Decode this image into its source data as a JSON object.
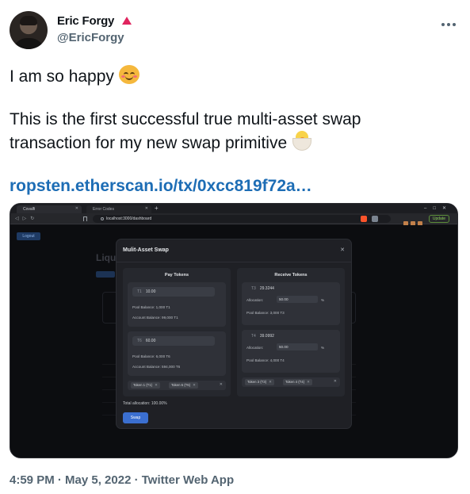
{
  "tweet": {
    "display_name": "Eric Forgy",
    "handle": "@EricForgy",
    "text_line1": "I am so happy",
    "text_line2": "This is the first successful true multi-asset swap",
    "text_line3": "transaction for my new swap primitive",
    "link": "ropsten.etherscan.io/tx/0xcc819f72a…",
    "meta": "4:59 PM · May 5, 2022 · Twitter Web App",
    "emoji_1": "smiling-face-with-smiling-eyes",
    "emoji_2": "hatching-chick",
    "badge_color": "#e0245e",
    "link_color": "#1d6db5"
  },
  "browser": {
    "tab_active": "Covalfi",
    "tab_second": "Error Codes",
    "url": "localhost:3000/dashboard",
    "update_label": "Update"
  },
  "app": {
    "logout_label": "Logout",
    "bg_title": "Liqu",
    "modal": {
      "title": "Mulit-Asset Swap",
      "pay_title": "Pay Tokens",
      "receive_title": "Receive Tokens",
      "pay_tokens": [
        {
          "symbol": "T1",
          "amount": "10.00",
          "pool_balance": "Pool Balance:   1,000   T1",
          "account_balance": "Account Balance:   99,000   T1"
        },
        {
          "symbol": "T6",
          "amount": "60.00",
          "pool_balance": "Pool Balance:   6,000   T6",
          "account_balance": "Account Balance:   594,000   T6"
        }
      ],
      "receive_tokens": [
        {
          "symbol": "T3",
          "amount": "29.3244",
          "allocation_label": "Allocation:",
          "allocation": "50.00",
          "pct": "%",
          "pool_balance": "Pool Balance:   3,000   T3"
        },
        {
          "symbol": "T4",
          "amount": "39.0992",
          "allocation_label": "Allocation:",
          "allocation": "50.00",
          "pct": "%",
          "pool_balance": "Pool Balance:   4,000   T4"
        }
      ],
      "pay_chips": [
        "Token 1 (T1)",
        "Token 6 (T6)"
      ],
      "receive_chips": [
        "Token 3 (T3)",
        "Token 4 (T4)"
      ],
      "total_allocation": "Total allocation: 100.00%",
      "swap_label": "Swap"
    }
  }
}
